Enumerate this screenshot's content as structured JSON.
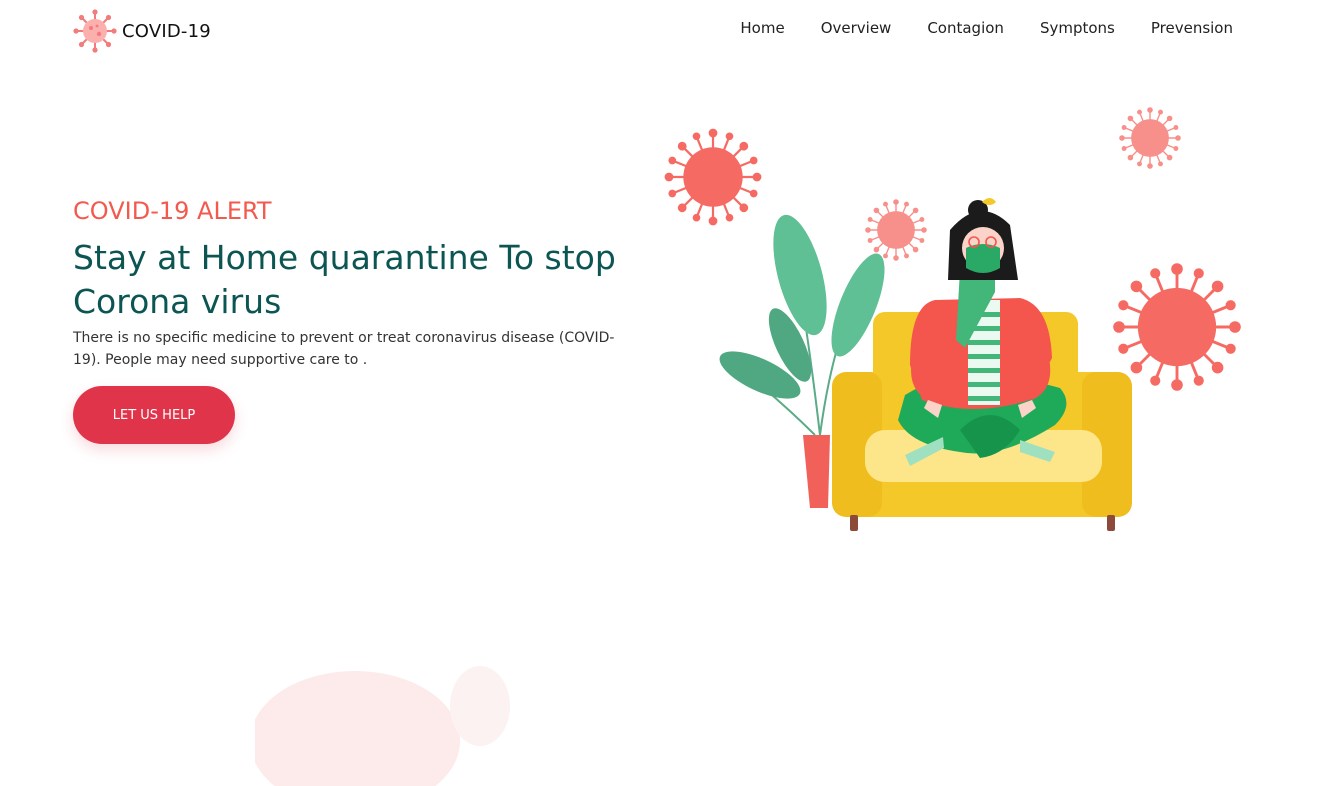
{
  "brand": {
    "name": "COVID-19",
    "logo_icon": "virus-icon"
  },
  "nav": {
    "items": [
      {
        "label": "Home"
      },
      {
        "label": "Overview"
      },
      {
        "label": "Contagion"
      },
      {
        "label": "Symptons"
      },
      {
        "label": "Prevension"
      }
    ]
  },
  "hero": {
    "eyebrow": "COVID-19 ALERT",
    "title": "Stay at Home quarantine To stop Corona virus",
    "description": "There is no specific medicine to prevent or treat coronavirus disease (COVID-19). People may need supportive care to .",
    "cta_label": "LET US HELP"
  },
  "colors": {
    "accent": "#f35a4e",
    "heading": "#0b5552",
    "cta": "#e0344a",
    "sofa": "#f5c82a"
  }
}
